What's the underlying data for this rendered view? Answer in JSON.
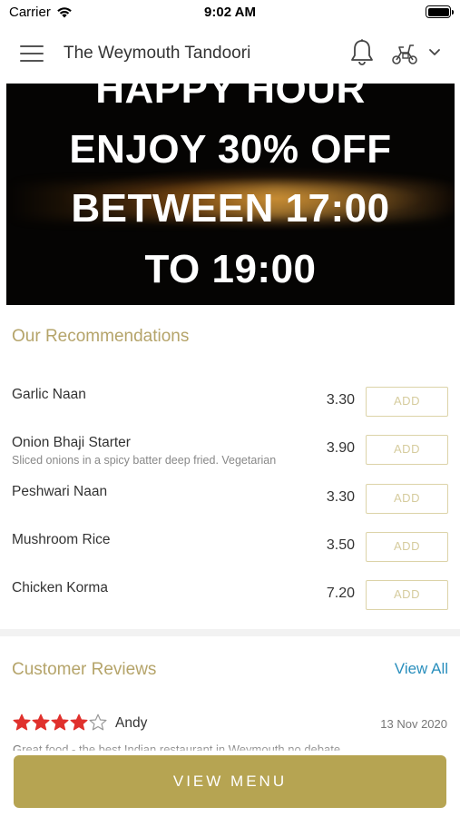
{
  "status_bar": {
    "carrier": "Carrier",
    "time": "9:02 AM"
  },
  "header": {
    "title": "The Weymouth Tandoori",
    "icons": [
      "hamburger-menu-icon",
      "bell-icon",
      "scooter-icon",
      "chevron-down-icon"
    ]
  },
  "banner": {
    "lines": [
      "HAPPY HOUR",
      "ENJOY 30% OFF",
      "BETWEEN 17:00",
      "TO 19:00"
    ]
  },
  "recommendations": {
    "title": "Our Recommendations",
    "add_label": "ADD",
    "items": [
      {
        "name": "Garlic Naan",
        "description": "",
        "price": "3.30"
      },
      {
        "name": "Onion Bhaji Starter",
        "description": "Sliced onions in a spicy batter deep fried. Vegetarian",
        "price": "3.90"
      },
      {
        "name": "Peshwari Naan",
        "description": "",
        "price": "3.30"
      },
      {
        "name": "Mushroom Rice",
        "description": "",
        "price": "3.50"
      },
      {
        "name": "Chicken Korma",
        "description": "",
        "price": "7.20"
      }
    ]
  },
  "reviews": {
    "title": "Customer Reviews",
    "view_all": "View All",
    "items": [
      {
        "rating": 4,
        "max_rating": 5,
        "reviewer": "Andy",
        "date": "13 Nov 2020",
        "text": "Great food - the best Indian restaurant in Weymouth no debate"
      }
    ]
  },
  "cta": {
    "view_menu": "VIEW MENU"
  },
  "colors": {
    "accent_gold": "#b6a452",
    "section_title": "#b5a46a",
    "link_blue": "#2a8fbd",
    "star_red": "#e0312d"
  }
}
